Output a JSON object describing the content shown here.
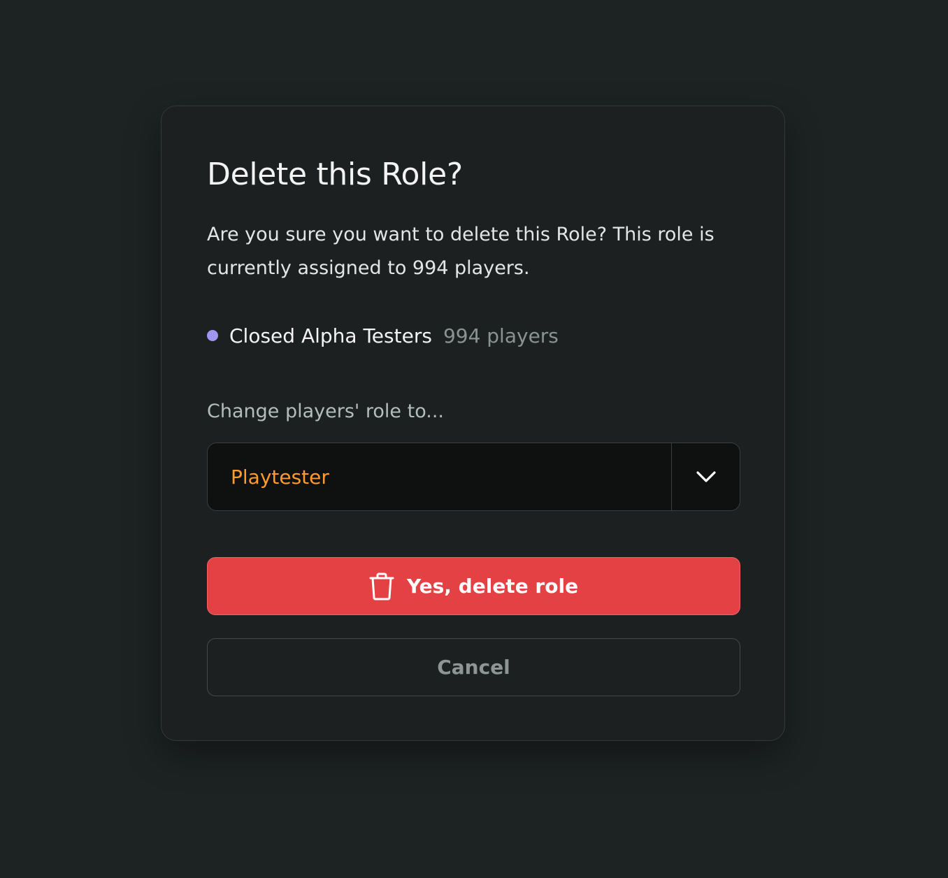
{
  "dialog": {
    "title": "Delete this Role?",
    "description": "Are you sure you want to delete this Role? This role is currently assigned to 994 players.",
    "role": {
      "name": "Closed Alpha Testers",
      "count": "994 players",
      "dot_color": "#a394f0"
    },
    "change_label": "Change players' role to...",
    "select": {
      "value": "Playtester",
      "value_color": "#ff9a2e",
      "icon": "chevron-down-icon"
    },
    "delete_button": {
      "label": "Yes, delete role",
      "icon": "trash-icon",
      "color": "#e44145"
    },
    "cancel_button": {
      "label": "Cancel"
    }
  }
}
